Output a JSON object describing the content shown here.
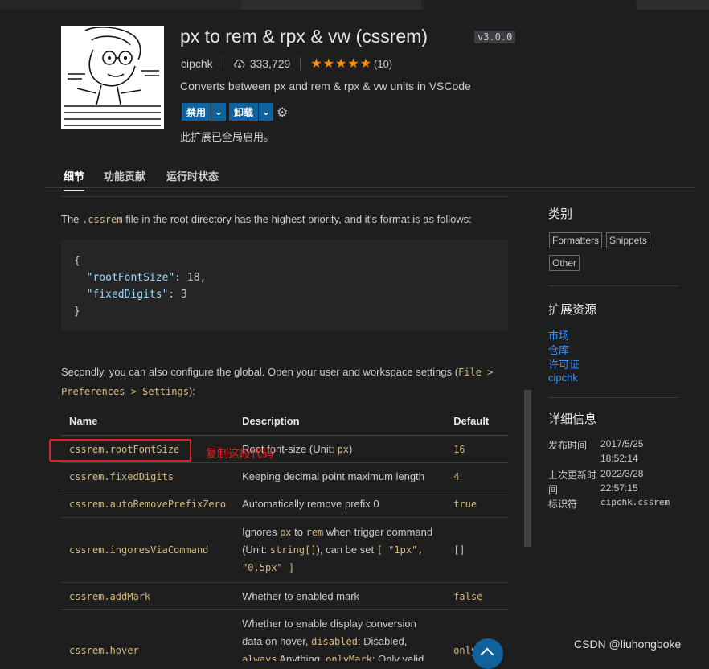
{
  "extension": {
    "title": "px to rem & rpx & vw (cssrem)",
    "version": "v3.0.0",
    "publisher": "cipchk",
    "installs": "333,729",
    "rating_stars": 5,
    "rating_count": "(10)",
    "description": "Converts between px and rem & rpx & vw units in VSCode",
    "disable_label": "禁用",
    "uninstall_label": "卸载",
    "enabled_note": "此扩展已全局启用。"
  },
  "tabs": [
    "细节",
    "功能贡献",
    "运行时状态"
  ],
  "content": {
    "para1_pre": "The ",
    "para1_code": ".cssrem",
    "para1_post": " file in the root directory has the highest priority, and it's format is as follows:",
    "code_open": "{",
    "code_k1": "\"rootFontSize\"",
    "code_v1": ": 18,",
    "code_k2": "\"fixedDigits\"",
    "code_v2": ": 3",
    "code_close": "}",
    "para2_pre": "Secondly, you can also configure the global. Open your user and workspace settings (",
    "para2_code": "File > Preferences > Settings",
    "para2_post": "):",
    "table": {
      "headers": [
        "Name",
        "Description",
        "Default"
      ],
      "rows": [
        {
          "name": "cssrem.rootFontSize",
          "desc_pre": "Root font-size (Unit: ",
          "desc_code": "px",
          "desc_post": ")",
          "default": "16"
        },
        {
          "name": "cssrem.fixedDigits",
          "desc": "Keeping decimal point maximum length",
          "default": "4"
        },
        {
          "name": "cssrem.autoRemovePrefixZero",
          "desc": "Automatically remove prefix 0",
          "default": "true"
        },
        {
          "name": "cssrem.ingoresViaCommand",
          "d1": "Ignores ",
          "c1": "px",
          "d2": " to ",
          "c2": "rem",
          "d3": " when trigger command (Unit: ",
          "c3": "string[]",
          "d4": "), can be set ",
          "c4": "[ \"1px\", \"0.5px\" ]",
          "default": "[]"
        },
        {
          "name": "cssrem.addMark",
          "desc": "Whether to enabled mark",
          "default": "false"
        },
        {
          "name": "cssrem.hover",
          "d1": "Whether to enable display conversion data on hover, ",
          "c1": "disabled",
          "d2": ": Disabled, ",
          "c2": "always",
          "d3": " Anything, ",
          "c3": "onlyMark",
          "d4": ": Only valid when",
          "default": "onlyMark"
        }
      ]
    },
    "annotation": "复制这段代码"
  },
  "sidebar": {
    "categories_title": "类别",
    "categories": [
      "Formatters",
      "Snippets",
      "Other"
    ],
    "resources_title": "扩展资源",
    "resources": [
      "市场",
      "仓库",
      "许可证",
      "cipchk"
    ],
    "details_title": "详细信息",
    "published_label": "发布时间",
    "published_value_1": "2017/5/25",
    "published_value_2": "18:52:14",
    "updated_label_1": "上次更新时",
    "updated_label_2": "间",
    "updated_value_1": "2022/3/28",
    "updated_value_2": "22:57:15",
    "identifier_label": "标识符",
    "identifier_value": "cipchk.cssrem"
  },
  "watermark": "CSDN @liuhongboke",
  "colors": {
    "accent": "#0e639c",
    "link": "#3794ff",
    "code": "#d7ba7d",
    "annotation": "#e02020",
    "stars": "#ff8e00"
  }
}
